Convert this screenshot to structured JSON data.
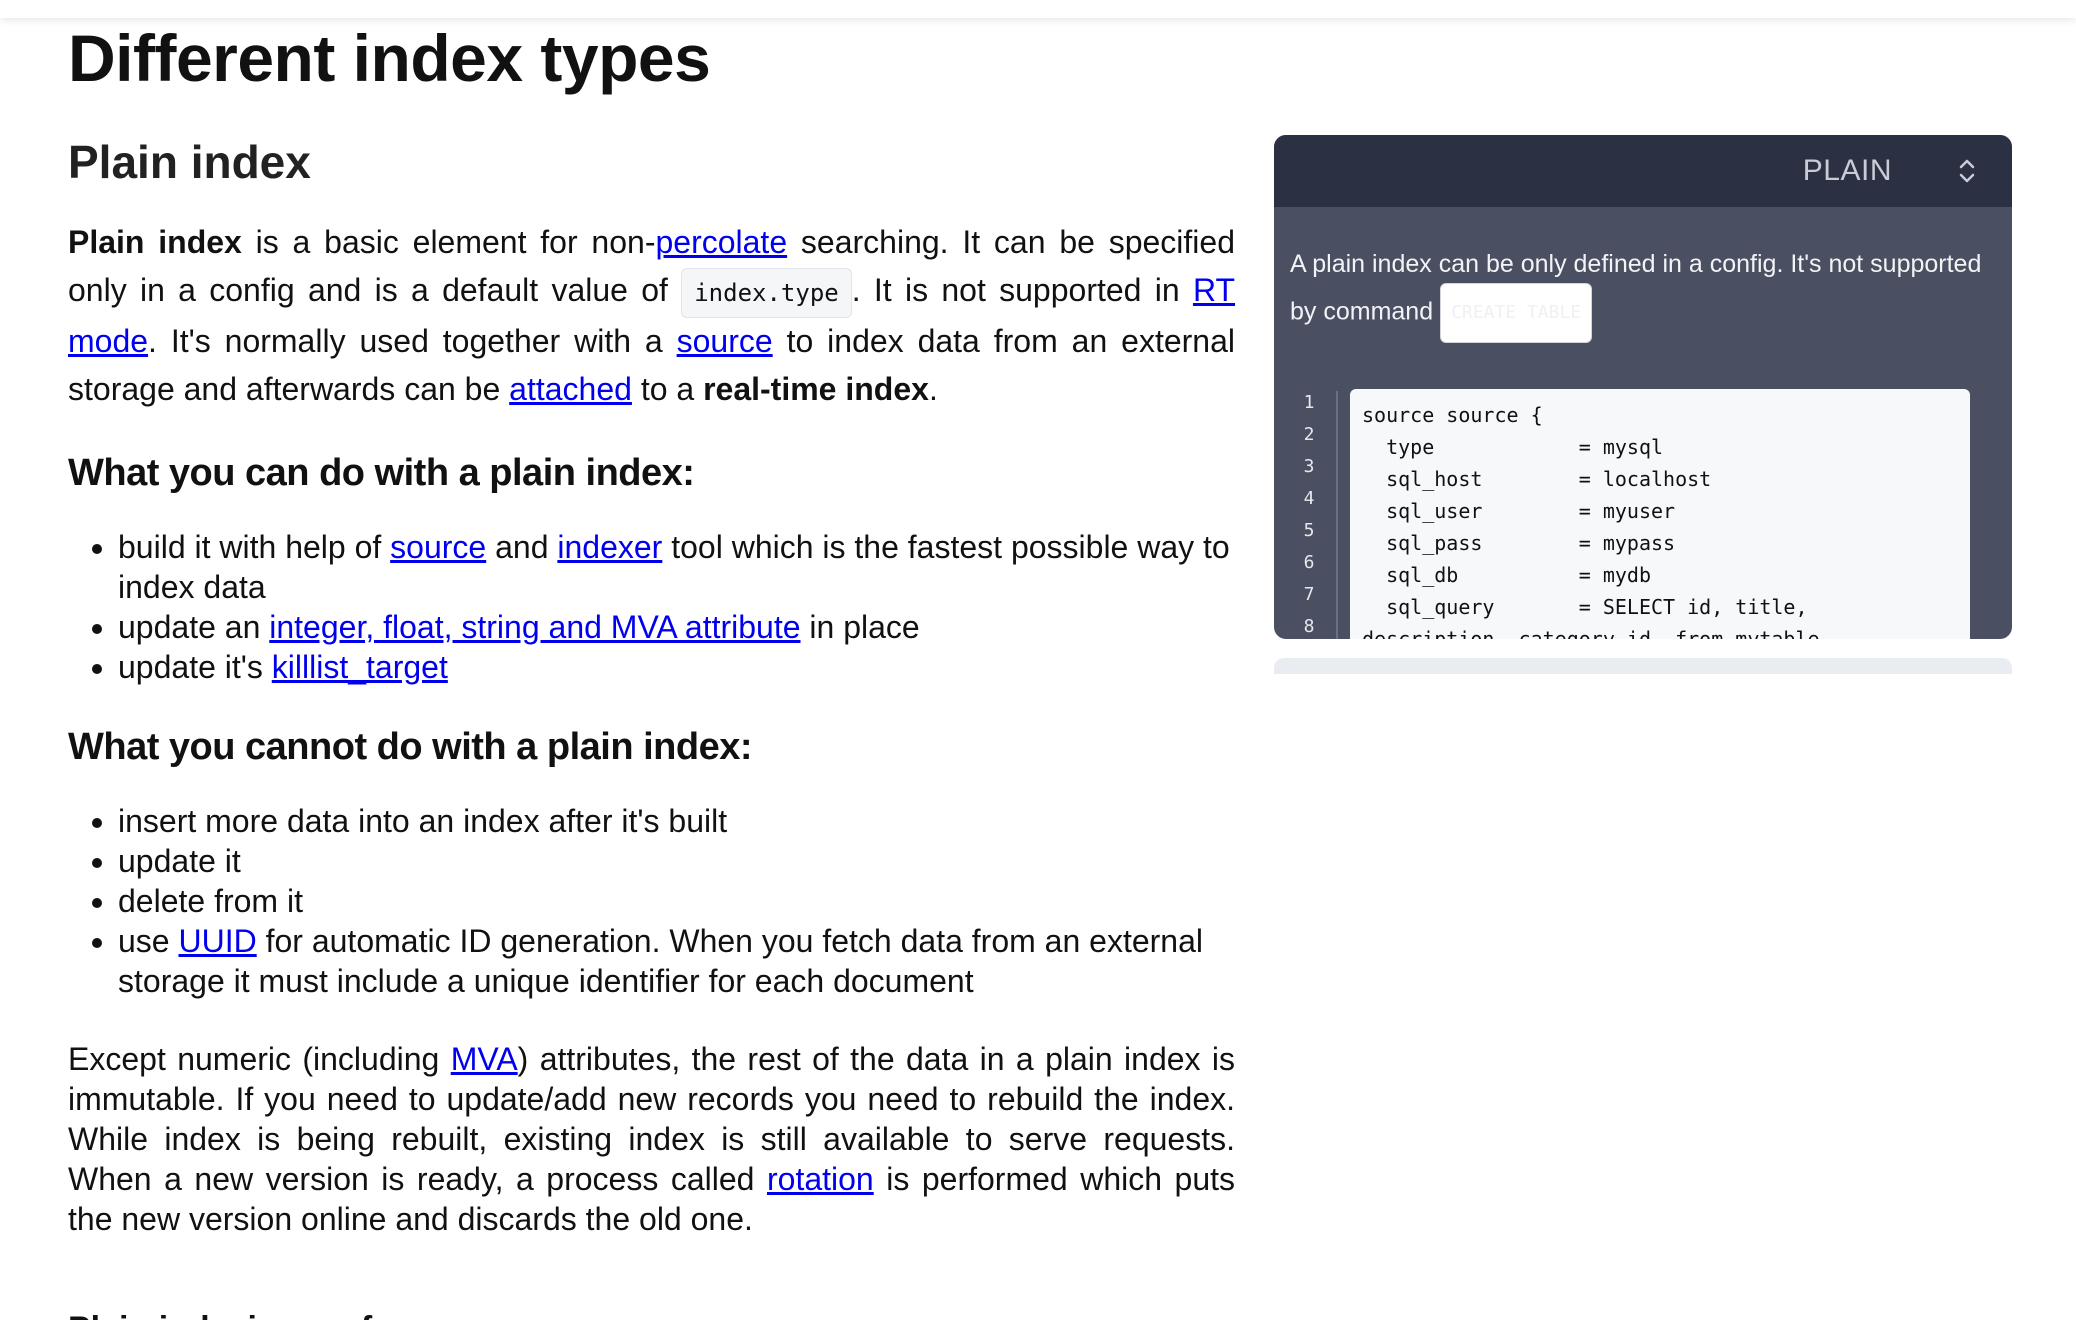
{
  "page_title": "Different index types",
  "section_title": "Plain index",
  "intro": {
    "bold_start": "Plain index",
    "t1": " is a basic element for non-",
    "link_percolate": "percolate",
    "t2": " searching. It can be specified only in a config and is a default value of ",
    "code_index_type": "index.type",
    "t3": ". It is not supported in ",
    "link_rt_mode": "RT mode",
    "t4": ". It's normally used together with a ",
    "link_source": "source",
    "t5": " to index data from an external storage and afterwards can be ",
    "link_attached": "attached",
    "t6": " to a ",
    "bold_rt": "real-time index",
    "t7": "."
  },
  "can_do": {
    "heading": "What you can do with a plain index:",
    "item1": {
      "t1": "build it with help of ",
      "link1": "source",
      "t2": " and ",
      "link2": "indexer",
      "t3": " tool which is the fastest possible way to index data"
    },
    "item2": {
      "t1": "update an ",
      "link1": "integer, float, string and MVA attribute",
      "t2": " in place"
    },
    "item3": {
      "t1": "update it's ",
      "link1": "killlist_target"
    }
  },
  "cannot_do": {
    "heading": "What you cannot do with a plain index:",
    "item1": "insert more data into an index after it's built",
    "item2": "update it",
    "item3": "delete from it",
    "item4": {
      "t1": "use ",
      "link1": "UUID",
      "t2": " for automatic ID generation. When you fetch data from an external storage it must include a unique identifier for each document"
    }
  },
  "para2": {
    "t1": "Except numeric (including ",
    "link_mva": "MVA",
    "t2": ") attributes, the rest of the data in a plain index is immutable. If you need to update/add new records you need to rebuild the index. While index is being rebuilt, existing index is still available to serve requests. When a new version is ready, a process called ",
    "link_rotation": "rotation",
    "t3": " is performed which puts the new version online and discards the old one."
  },
  "perf_heading": "Plain indexing performance",
  "panel": {
    "selector_value": "PLAIN",
    "description": "A plain index can be only defined in a config. It's not supported by command",
    "command_pill": "CREATE TABLE",
    "line_numbers": [
      "1",
      "2",
      "3",
      "4",
      "5",
      "6",
      "7",
      "8"
    ],
    "code_lines": [
      "source source {",
      "  type            = mysql",
      "  sql_host        = localhost",
      "  sql_user        = myuser",
      "  sql_pass        = mypass",
      "  sql_db          = mydb",
      "  sql_query       = SELECT id, title,",
      "description, category_id  from mytable"
    ]
  },
  "colors": {
    "link": "#0000ee",
    "panel_bg": "#4a5061",
    "panel_header_bg": "#2b3042",
    "code_bg": "#f6f8fa"
  }
}
